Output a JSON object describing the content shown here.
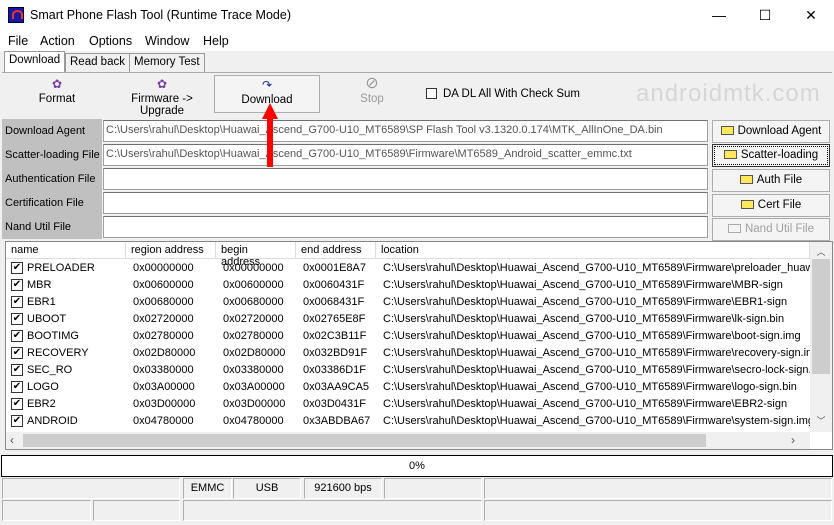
{
  "window": {
    "title": "Smart Phone Flash Tool (Runtime Trace Mode)",
    "minimize": "—",
    "maximize": "☐",
    "close": "✕"
  },
  "menu": [
    "File",
    "Action",
    "Options",
    "Window",
    "Help"
  ],
  "tabs": [
    "Download",
    "Read back",
    "Memory Test"
  ],
  "toolbar": {
    "format": "Format",
    "firmware_upgrade": "Firmware -> Upgrade",
    "download": "Download",
    "stop": "Stop",
    "checksum_label": "DA DL All With Check Sum",
    "checksum_checked": false
  },
  "watermark": "androidmtk.com",
  "files": [
    {
      "label": "Download Agent",
      "value": "C:\\Users\\rahul\\Desktop\\Huawai_Ascend_G700-U10_MT6589\\SP Flash Tool v3.1320.0.174\\MTK_AllInOne_DA.bin",
      "button": "Download Agent"
    },
    {
      "label": "Scatter-loading File",
      "value": "C:\\Users\\rahul\\Desktop\\Huawai_Ascend_G700-U10_MT6589\\Firmware\\MT6589_Android_scatter_emmc.txt",
      "button": "Scatter-loading"
    },
    {
      "label": "Authentication File",
      "value": "",
      "button": "Auth File"
    },
    {
      "label": "Certification File",
      "value": "",
      "button": "Cert File"
    },
    {
      "label": "Nand Util File",
      "value": "",
      "button": "Nand Util File"
    }
  ],
  "table": {
    "columns": [
      "name",
      "region address",
      "begin address",
      "end address",
      "location"
    ],
    "rows": [
      [
        "PRELOADER",
        "0x00000000",
        "0x00000000",
        "0x0001E8A7",
        "C:\\Users\\rahul\\Desktop\\Huawai_Ascend_G700-U10_MT6589\\Firmware\\preloader_huaw"
      ],
      [
        "MBR",
        "0x00600000",
        "0x00600000",
        "0x0060431F",
        "C:\\Users\\rahul\\Desktop\\Huawai_Ascend_G700-U10_MT6589\\Firmware\\MBR-sign"
      ],
      [
        "EBR1",
        "0x00680000",
        "0x00680000",
        "0x0068431F",
        "C:\\Users\\rahul\\Desktop\\Huawai_Ascend_G700-U10_MT6589\\Firmware\\EBR1-sign"
      ],
      [
        "UBOOT",
        "0x02720000",
        "0x02720000",
        "0x02765E8F",
        "C:\\Users\\rahul\\Desktop\\Huawai_Ascend_G700-U10_MT6589\\Firmware\\lk-sign.bin"
      ],
      [
        "BOOTIMG",
        "0x02780000",
        "0x02780000",
        "0x02C3B11F",
        "C:\\Users\\rahul\\Desktop\\Huawai_Ascend_G700-U10_MT6589\\Firmware\\boot-sign.img"
      ],
      [
        "RECOVERY",
        "0x02D80000",
        "0x02D80000",
        "0x032BD91F",
        "C:\\Users\\rahul\\Desktop\\Huawai_Ascend_G700-U10_MT6589\\Firmware\\recovery-sign.im"
      ],
      [
        "SEC_RO",
        "0x03380000",
        "0x03380000",
        "0x03386D1F",
        "C:\\Users\\rahul\\Desktop\\Huawai_Ascend_G700-U10_MT6589\\Firmware\\secro-lock-sign.i"
      ],
      [
        "LOGO",
        "0x03A00000",
        "0x03A00000",
        "0x03AA9CA5",
        "C:\\Users\\rahul\\Desktop\\Huawai_Ascend_G700-U10_MT6589\\Firmware\\logo-sign.bin"
      ],
      [
        "EBR2",
        "0x03D00000",
        "0x03D00000",
        "0x03D0431F",
        "C:\\Users\\rahul\\Desktop\\Huawai_Ascend_G700-U10_MT6589\\Firmware\\EBR2-sign"
      ],
      [
        "ANDROID",
        "0x04780000",
        "0x04780000",
        "0x3ABDBA67",
        "C:\\Users\\rahul\\Desktop\\Huawai_Ascend_G700-U10_MT6589\\Firmware\\system-sign.img"
      ]
    ]
  },
  "progress": {
    "text": "0%",
    "value": 0
  },
  "status": {
    "storage": "EMMC",
    "connection": "USB",
    "baud": "921600 bps"
  },
  "colors": {
    "arrow": "#ff0000",
    "label_bg": "#c0c0c0"
  }
}
